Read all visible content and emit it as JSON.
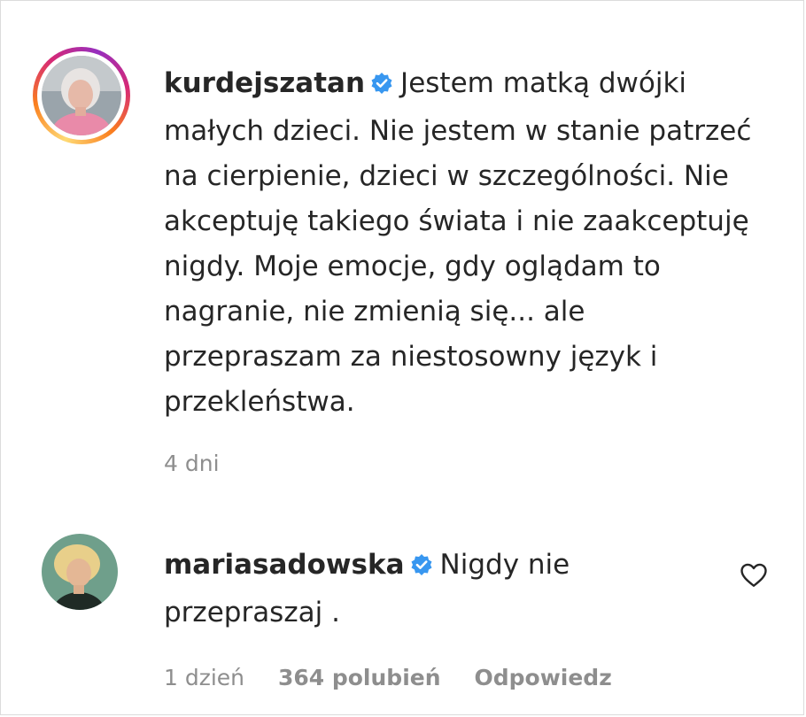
{
  "comments": [
    {
      "username": "kurdejszatan",
      "verified": true,
      "lines": [
        "Jestem matką dwójki",
        "małych dzieci. Nie jestem w stanie patrzeć",
        "na cierpienie, dzieci w szczególności. Nie",
        "akceptuję takiego świata i nie zaakceptuję",
        "nigdy. Moje emocje, gdy oglądam to",
        "nagranie, nie zmienią się... ale",
        "przepraszam za niestosowny język i",
        "przekleństwa."
      ],
      "time": "4 dni",
      "has_story_ring": true
    },
    {
      "username": "mariasadowska",
      "verified": true,
      "lines": [
        "Nigdy nie",
        "przepraszaj ."
      ],
      "time": "1 dzień",
      "likes": "364 polubień",
      "reply": "Odpowiedz",
      "has_story_ring": false,
      "icon": "heart-outline-icon"
    }
  ],
  "colors": {
    "text": "#262626",
    "secondary": "#8e8e8e",
    "verified_blue": "#3897f0",
    "border": "#dbdbdb"
  }
}
